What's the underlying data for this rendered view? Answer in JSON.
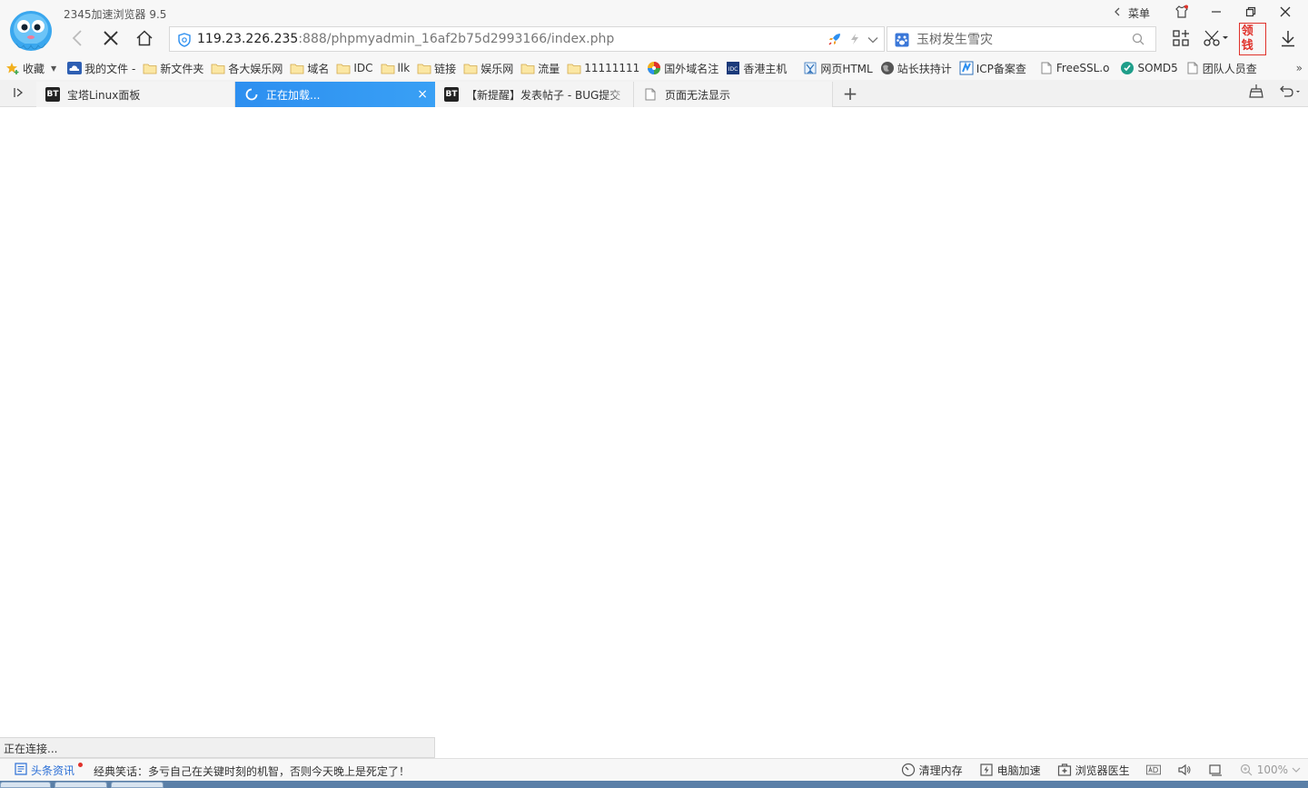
{
  "window": {
    "title": "2345加速浏览器 9.5",
    "menu_label": "菜单"
  },
  "address_bar": {
    "url_host": "119.23.226.235",
    "url_rest": ":888/phpmyadmin_16af2b75d2993166/index.php"
  },
  "search": {
    "placeholder": "玉树发生雪灾"
  },
  "toolbar": {
    "redpacket_label": "领钱"
  },
  "bookmarks": [
    {
      "label": "收藏",
      "icon": "star-plus-icon",
      "has_caret": true
    },
    {
      "label": "我的文件 -",
      "icon": "cloud-icon"
    },
    {
      "label": "新文件夹",
      "icon": "folder-icon"
    },
    {
      "label": "各大娱乐网",
      "icon": "folder-icon"
    },
    {
      "label": "域名",
      "icon": "folder-icon"
    },
    {
      "label": "IDC",
      "icon": "folder-icon"
    },
    {
      "label": "llk",
      "icon": "folder-icon"
    },
    {
      "label": "链接",
      "icon": "folder-icon"
    },
    {
      "label": "娱乐网",
      "icon": "folder-icon"
    },
    {
      "label": "流量",
      "icon": "folder-icon"
    },
    {
      "label": "11111111",
      "icon": "folder-icon"
    },
    {
      "label": "国外域名注",
      "icon": "colorwheel-icon"
    },
    {
      "label": "香港主机",
      "icon": "idc-icon"
    },
    {
      "label": "网页HTML",
      "icon": "figure-icon"
    },
    {
      "label": "站长扶持计",
      "icon": "globe-icon"
    },
    {
      "label": "ICP备案查",
      "icon": "icp-icon"
    },
    {
      "label": "FreeSSL.o",
      "icon": "page-icon"
    },
    {
      "label": "SOMD5",
      "icon": "somd5-icon"
    },
    {
      "label": "团队人员查",
      "icon": "page-icon"
    }
  ],
  "bookmarks_more": "»",
  "tabs": [
    {
      "label": "宝塔Linux面板",
      "favicon": "BT",
      "active": false
    },
    {
      "label": "正在加载...",
      "favicon": "spinner",
      "active": true,
      "close": "×"
    },
    {
      "label": "【新提醒】发表帖子 - BUG提交",
      "favicon": "BT",
      "active": false
    },
    {
      "label": "页面无法显示",
      "favicon": "page",
      "active": false
    }
  ],
  "newtab_label": "+",
  "status_bubble": "正在连接...",
  "bottom": {
    "news_label": "头条资讯",
    "joke_text": "经典笑话：多亏自己在关键时刻的机智，否则今天晚上是死定了！",
    "tools": [
      {
        "label": "清理内存",
        "icon": "gauge-icon"
      },
      {
        "label": "电脑加速",
        "icon": "bolt-icon"
      },
      {
        "label": "浏览器医生",
        "icon": "doctor-icon"
      }
    ],
    "zoom": "100%"
  },
  "colors": {
    "accent": "#2d8ff0",
    "red": "#e0322b"
  }
}
